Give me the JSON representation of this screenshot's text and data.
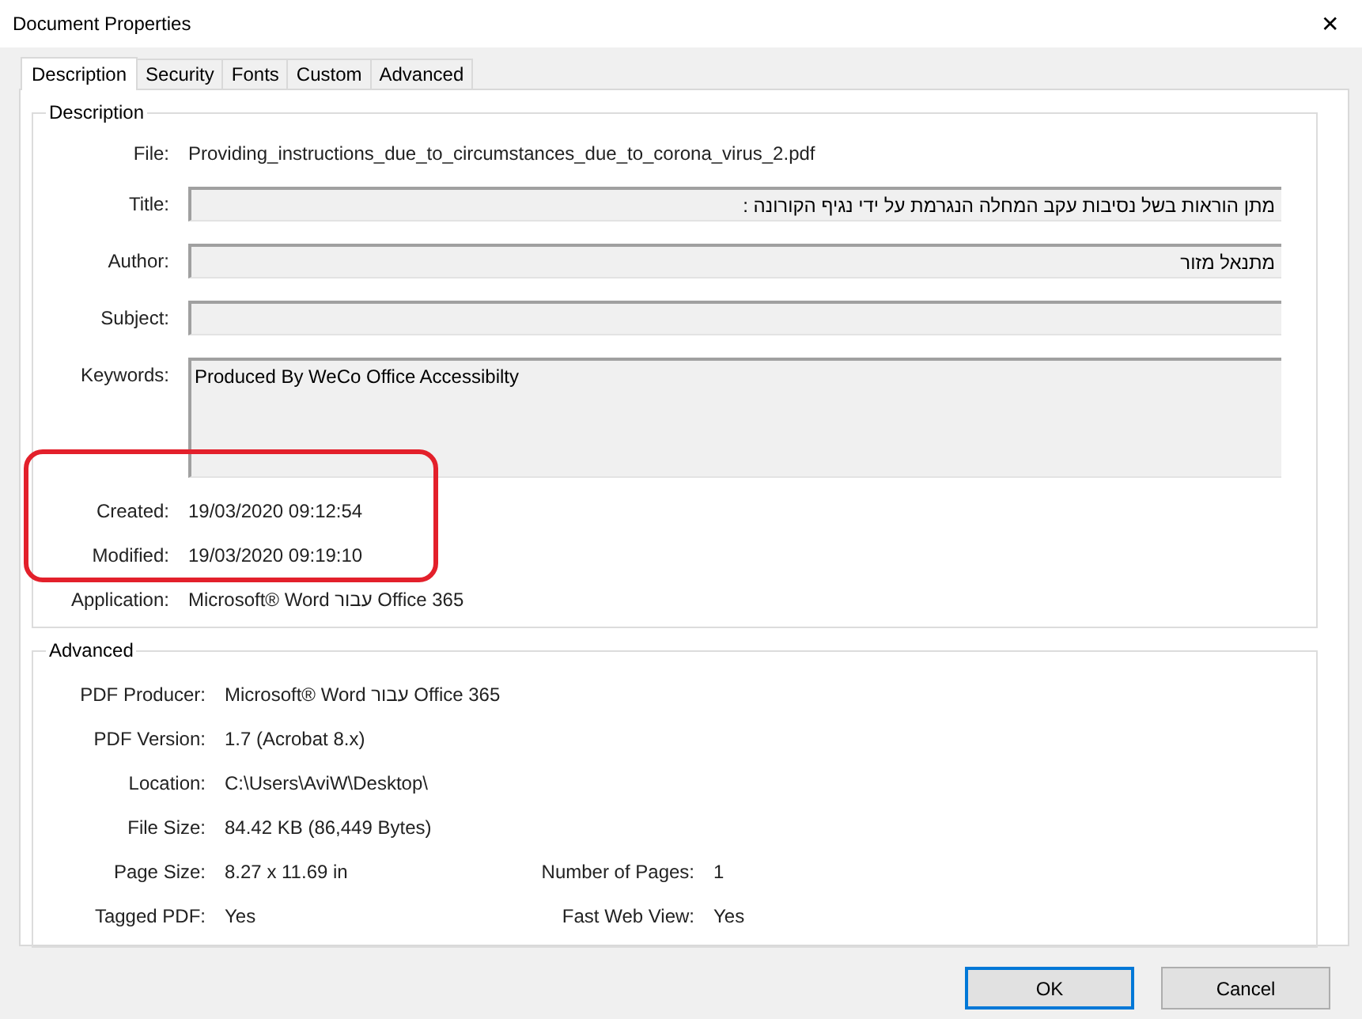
{
  "window": {
    "title": "Document Properties",
    "close": "✕"
  },
  "tabs": [
    {
      "label": "Description",
      "selected": true
    },
    {
      "label": "Security",
      "selected": false
    },
    {
      "label": "Fonts",
      "selected": false
    },
    {
      "label": "Custom",
      "selected": false
    },
    {
      "label": "Advanced",
      "selected": false
    }
  ],
  "description": {
    "legend": "Description",
    "rows": [
      {
        "kind": "text",
        "label": "File:",
        "value": "Providing_instructions_due_to_circumstances_due_to_corona_virus_2.pdf"
      },
      {
        "kind": "field",
        "label": "Title:",
        "value": "מתן הוראות בשל נסיבות עקב המחלה הנגרמת על ידי נגיף הקורונה :"
      },
      {
        "kind": "field",
        "label": "Author:",
        "value": "מתנאל מזור"
      },
      {
        "kind": "field",
        "label": "Subject:"
      },
      {
        "kind": "area",
        "label": "Keywords:",
        "value": "Produced By WeCo Office Accessibilty"
      },
      {
        "kind": "text",
        "label": "Created:",
        "value": "19/03/2020 09:12:54"
      },
      {
        "kind": "text",
        "label": "Modified:",
        "value": "19/03/2020 09:19:10"
      },
      {
        "kind": "text",
        "label": "Application:",
        "value": "Microsoft® Word עבור Office 365"
      }
    ]
  },
  "annotations": [
    {
      "kind": "outline",
      "color": "#e3202b"
    }
  ],
  "advanced": {
    "legend": "Advanced",
    "rows": [
      {
        "label": "PDF Producer:",
        "value": "Microsoft® Word עבור Office 365"
      },
      {
        "label": "PDF Version:",
        "value": "1.7 (Acrobat 8.x)"
      },
      {
        "label": "Location:",
        "value": "C:\\Users\\AviW\\Desktop\\"
      },
      {
        "label": "File Size:",
        "value": "84.42 KB (86,449 Bytes)"
      },
      {
        "label": "Page Size:",
        "value": "8.27 x 11.69 in",
        "label_2": "Number of Pages:",
        "value_2": "1"
      },
      {
        "label": "Tagged PDF:",
        "value": "Yes",
        "label_2": "Fast Web View:",
        "value_2": "Yes"
      }
    ]
  },
  "buttons": [
    {
      "label": "OK",
      "default": true
    },
    {
      "label": "Cancel",
      "default": false
    }
  ]
}
